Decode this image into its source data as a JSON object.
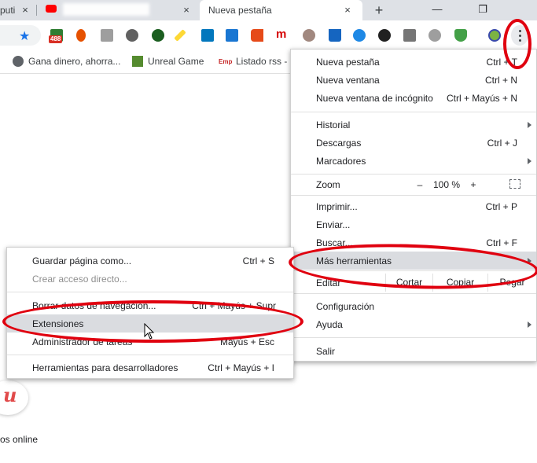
{
  "tabs": [
    {
      "label": "puti",
      "active": false
    },
    {
      "label": "",
      "active": false
    },
    {
      "label": "Nueva pestaña",
      "active": true
    }
  ],
  "icons": {
    "close": "×",
    "new_tab": "+",
    "minimize": "—",
    "restore": "❐",
    "star": "★"
  },
  "toolbar": {
    "badge_count": "488"
  },
  "bookmarks": [
    {
      "label": "Gana dinero, ahorra...",
      "icon": "globe-icon"
    },
    {
      "label": "Unreal Game",
      "icon": "unreal-icon"
    },
    {
      "label": "Listado rss -",
      "icon": "emp-icon",
      "icon_text": "Emp"
    }
  ],
  "main_menu": {
    "new_tab": {
      "label": "Nueva pestaña",
      "shortcut": "Ctrl + T"
    },
    "new_window": {
      "label": "Nueva ventana",
      "shortcut": "Ctrl + N"
    },
    "incognito": {
      "label": "Nueva ventana de incógnito",
      "shortcut": "Ctrl + Mayús + N"
    },
    "history": {
      "label": "Historial"
    },
    "downloads": {
      "label": "Descargas",
      "shortcut": "Ctrl + J"
    },
    "bookmarks": {
      "label": "Marcadores"
    },
    "zoom": {
      "label": "Zoom",
      "minus": "–",
      "value": "100 %",
      "plus": "+"
    },
    "print": {
      "label": "Imprimir...",
      "shortcut": "Ctrl + P"
    },
    "cast": {
      "label": "Enviar..."
    },
    "find": {
      "label": "Buscar...",
      "shortcut": "Ctrl + F"
    },
    "more_tools": {
      "label": "Más herramientas"
    },
    "edit": {
      "label": "Editar",
      "cut": "Cortar",
      "copy": "Copiar",
      "paste": "Pegar"
    },
    "settings": {
      "label": "Configuración"
    },
    "help": {
      "label": "Ayuda"
    },
    "exit": {
      "label": "Salir"
    }
  },
  "submenu": {
    "save_page": {
      "label": "Guardar página como...",
      "shortcut": "Ctrl + S"
    },
    "create_shortcut": {
      "label": "Crear acceso directo..."
    },
    "clear_data": {
      "label": "Borrar datos de navegación...",
      "shortcut": "Ctrl + Mayús + Supr"
    },
    "extensions": {
      "label": "Extensiones"
    },
    "task_manager": {
      "label": "Administrador de tareas",
      "shortcut": "Mayús + Esc"
    },
    "dev_tools": {
      "label": "Herramientas para desarrolladores",
      "shortcut": "Ctrl + Mayús + I"
    }
  },
  "page": {
    "logo_letter": "u",
    "caption": "os online"
  },
  "colors": {
    "annotation": "#e0000f",
    "highlight": "#dadce0"
  }
}
